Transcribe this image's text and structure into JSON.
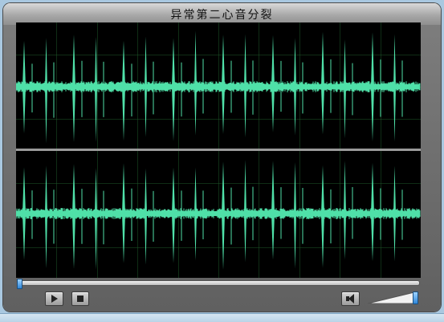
{
  "window": {
    "title": "异常第二心音分裂"
  },
  "waveform": {
    "channels": 2,
    "waveform_color": "#4fe0a8",
    "background_color": "#000000",
    "grid_color": "#1f5a2a",
    "divider_color": "#9a9a9a"
  },
  "player": {
    "seek_position": 0.0,
    "volume_level": 1.0,
    "accent_color": "#2e86d9",
    "icons": {
      "play": "play-icon",
      "stop": "stop-icon",
      "speaker": "speaker-icon"
    }
  }
}
